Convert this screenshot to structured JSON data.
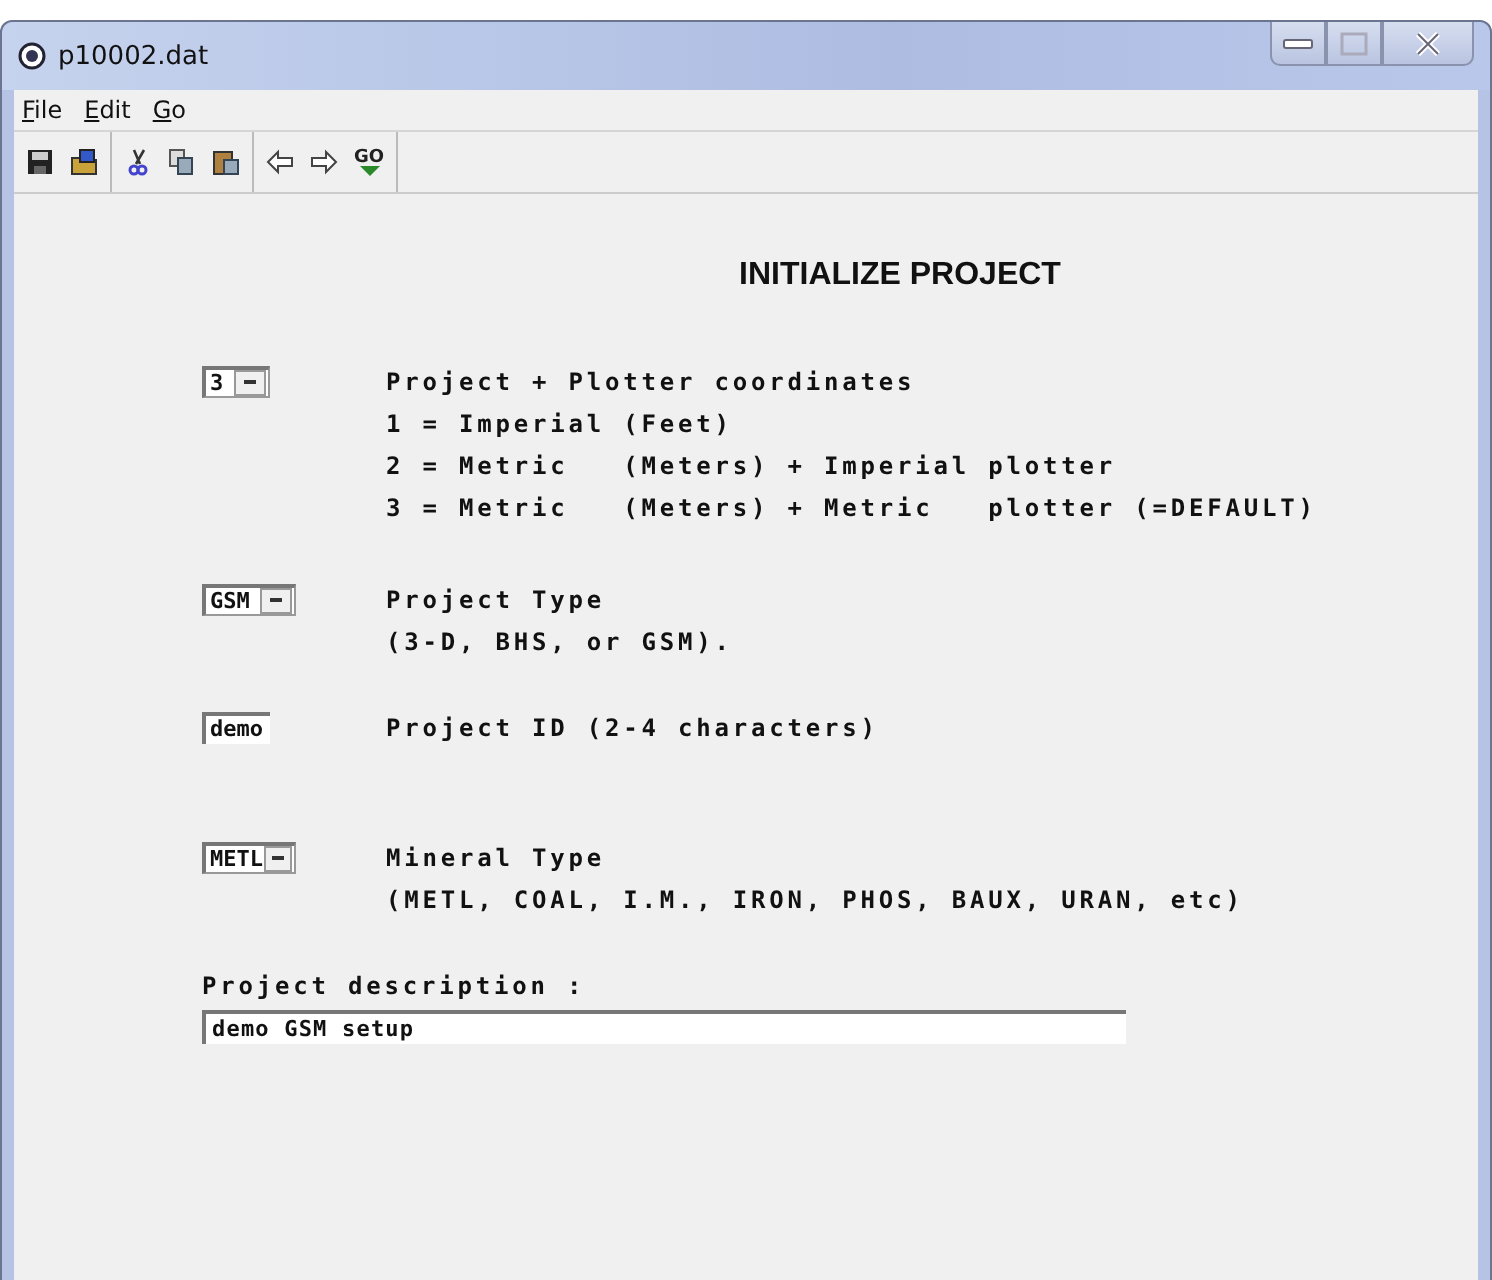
{
  "window": {
    "title": "p10002.dat"
  },
  "menu": [
    {
      "label": "File"
    },
    {
      "label": "Edit"
    },
    {
      "label": "Go"
    }
  ],
  "toolbar": {
    "go_label": "GO"
  },
  "heading": "INITIALIZE PROJECT",
  "rows": [
    {
      "kind": "dropdown",
      "value": "3",
      "lines": [
        "Project + Plotter coordinates",
        "1 = Imperial (Feet)",
        "2 = Metric   (Meters) + Imperial plotter",
        "3 = Metric   (Meters) + Metric   plotter (=DEFAULT)"
      ]
    },
    {
      "kind": "dropdown",
      "value": "GSM",
      "lines": [
        "Project Type",
        "(3-D, BHS, or GSM)."
      ]
    },
    {
      "kind": "text",
      "value": "demo",
      "lines": [
        "Project ID (2-4 characters)"
      ]
    },
    {
      "kind": "dropdown",
      "value": "METL",
      "lines": [
        "Mineral Type",
        "(METL, COAL, I.M., IRON, PHOS, BAUX, URAN, etc)"
      ]
    }
  ],
  "description": {
    "label": "Project description :",
    "value": "demo GSM setup"
  }
}
